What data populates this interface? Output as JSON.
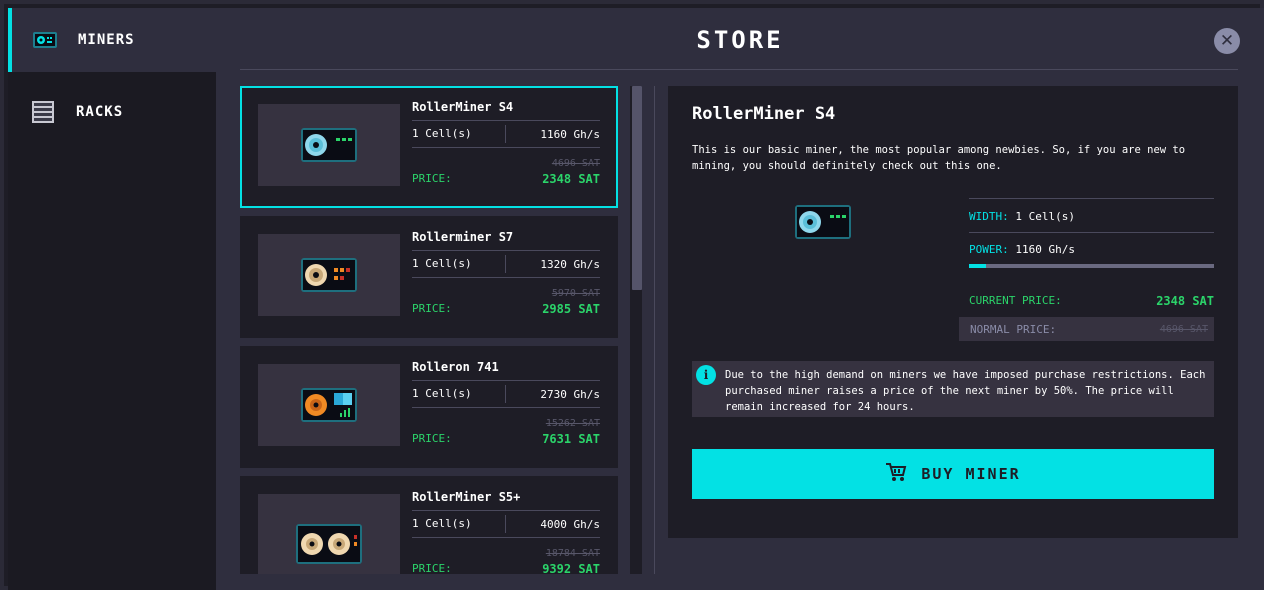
{
  "sidebar": {
    "items": [
      {
        "label": "MINERS",
        "icon": "miner-icon",
        "active": true
      },
      {
        "label": "RACKS",
        "icon": "rack-icon",
        "active": false
      }
    ]
  },
  "header": {
    "title": "STORE",
    "close_icon": "close-icon"
  },
  "products": [
    {
      "name": "RollerMiner S4",
      "cells": "1 Cell(s)",
      "power": "1160 Gh/s",
      "old_price": "4696 SAT",
      "price_label": "PRICE:",
      "price": "2348 SAT",
      "icon": "rollerminer-s4-icon"
    },
    {
      "name": "Rollerminer S7",
      "cells": "1 Cell(s)",
      "power": "1320 Gh/s",
      "old_price": "5970 SAT",
      "price_label": "PRICE:",
      "price": "2985 SAT",
      "icon": "rollerminer-s7-icon"
    },
    {
      "name": "Rolleron 741",
      "cells": "1 Cell(s)",
      "power": "2730 Gh/s",
      "old_price": "15262 SAT",
      "price_label": "PRICE:",
      "price": "7631 SAT",
      "icon": "rolleron-741-icon"
    },
    {
      "name": "RollerMiner S5+",
      "cells": "1 Cell(s)",
      "power": "4000 Gh/s",
      "old_price": "18784 SAT",
      "price_label": "PRICE:",
      "price": "9392 SAT",
      "icon": "rollerminer-s5plus-icon"
    }
  ],
  "detail": {
    "title": "RollerMiner S4",
    "description": "This is our basic miner, the most popular among newbies. So, if you are new to mining, you should definitely check out this one.",
    "width_label": "WIDTH:",
    "width_value": "1 Cell(s)",
    "power_label": "POWER:",
    "power_value": "1160 Gh/s",
    "power_fraction": 0.07,
    "current_price_label": "CURRENT PRICE:",
    "current_price": "2348 SAT",
    "normal_price_label": "NORMAL PRICE:",
    "normal_price": "4696 SAT",
    "notice": "Due to the high demand on miners we have imposed purchase restrictions. Each purchased miner raises a price of the next miner by 50%. The price will remain increased for 24 hours.",
    "buy_label": "BUY MINER"
  },
  "colors": {
    "accent": "#03e1e4",
    "price_green": "#2bd46a",
    "panel_bg": "#2f2e3e",
    "card_bg": "#1e1d26"
  }
}
